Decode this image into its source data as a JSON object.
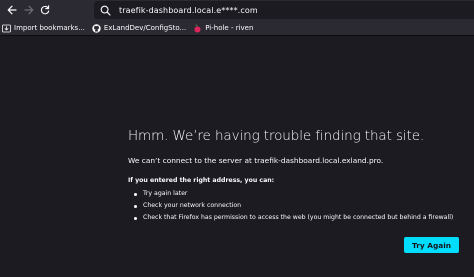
{
  "browser": {
    "url": "traefik-dashboard.local.e****.com"
  },
  "bookmarks": [
    {
      "label": "Import bookmarks...",
      "icon": "import-icon"
    },
    {
      "label": "ExLandDev/ConfigSto...",
      "icon": "github-icon"
    },
    {
      "label": "Pi-hole - riven",
      "icon": "pihole-icon"
    }
  ],
  "error": {
    "title": "Hmm. We’re having trouble finding that site.",
    "description": "We can’t connect to the server at traefik-dashboard.local.exland.pro.",
    "subheading": "If you entered the right address, you can:",
    "suggestions": [
      "Try again later",
      "Check your network connection",
      "Check that Firefox has permission to access the web (you might be connected but behind a firewall)"
    ],
    "try_again_label": "Try Again"
  },
  "colors": {
    "background": "#1c1b22",
    "toolbar": "#2b2a33",
    "text": "#fbfbfe",
    "accent": "#00ddff"
  }
}
